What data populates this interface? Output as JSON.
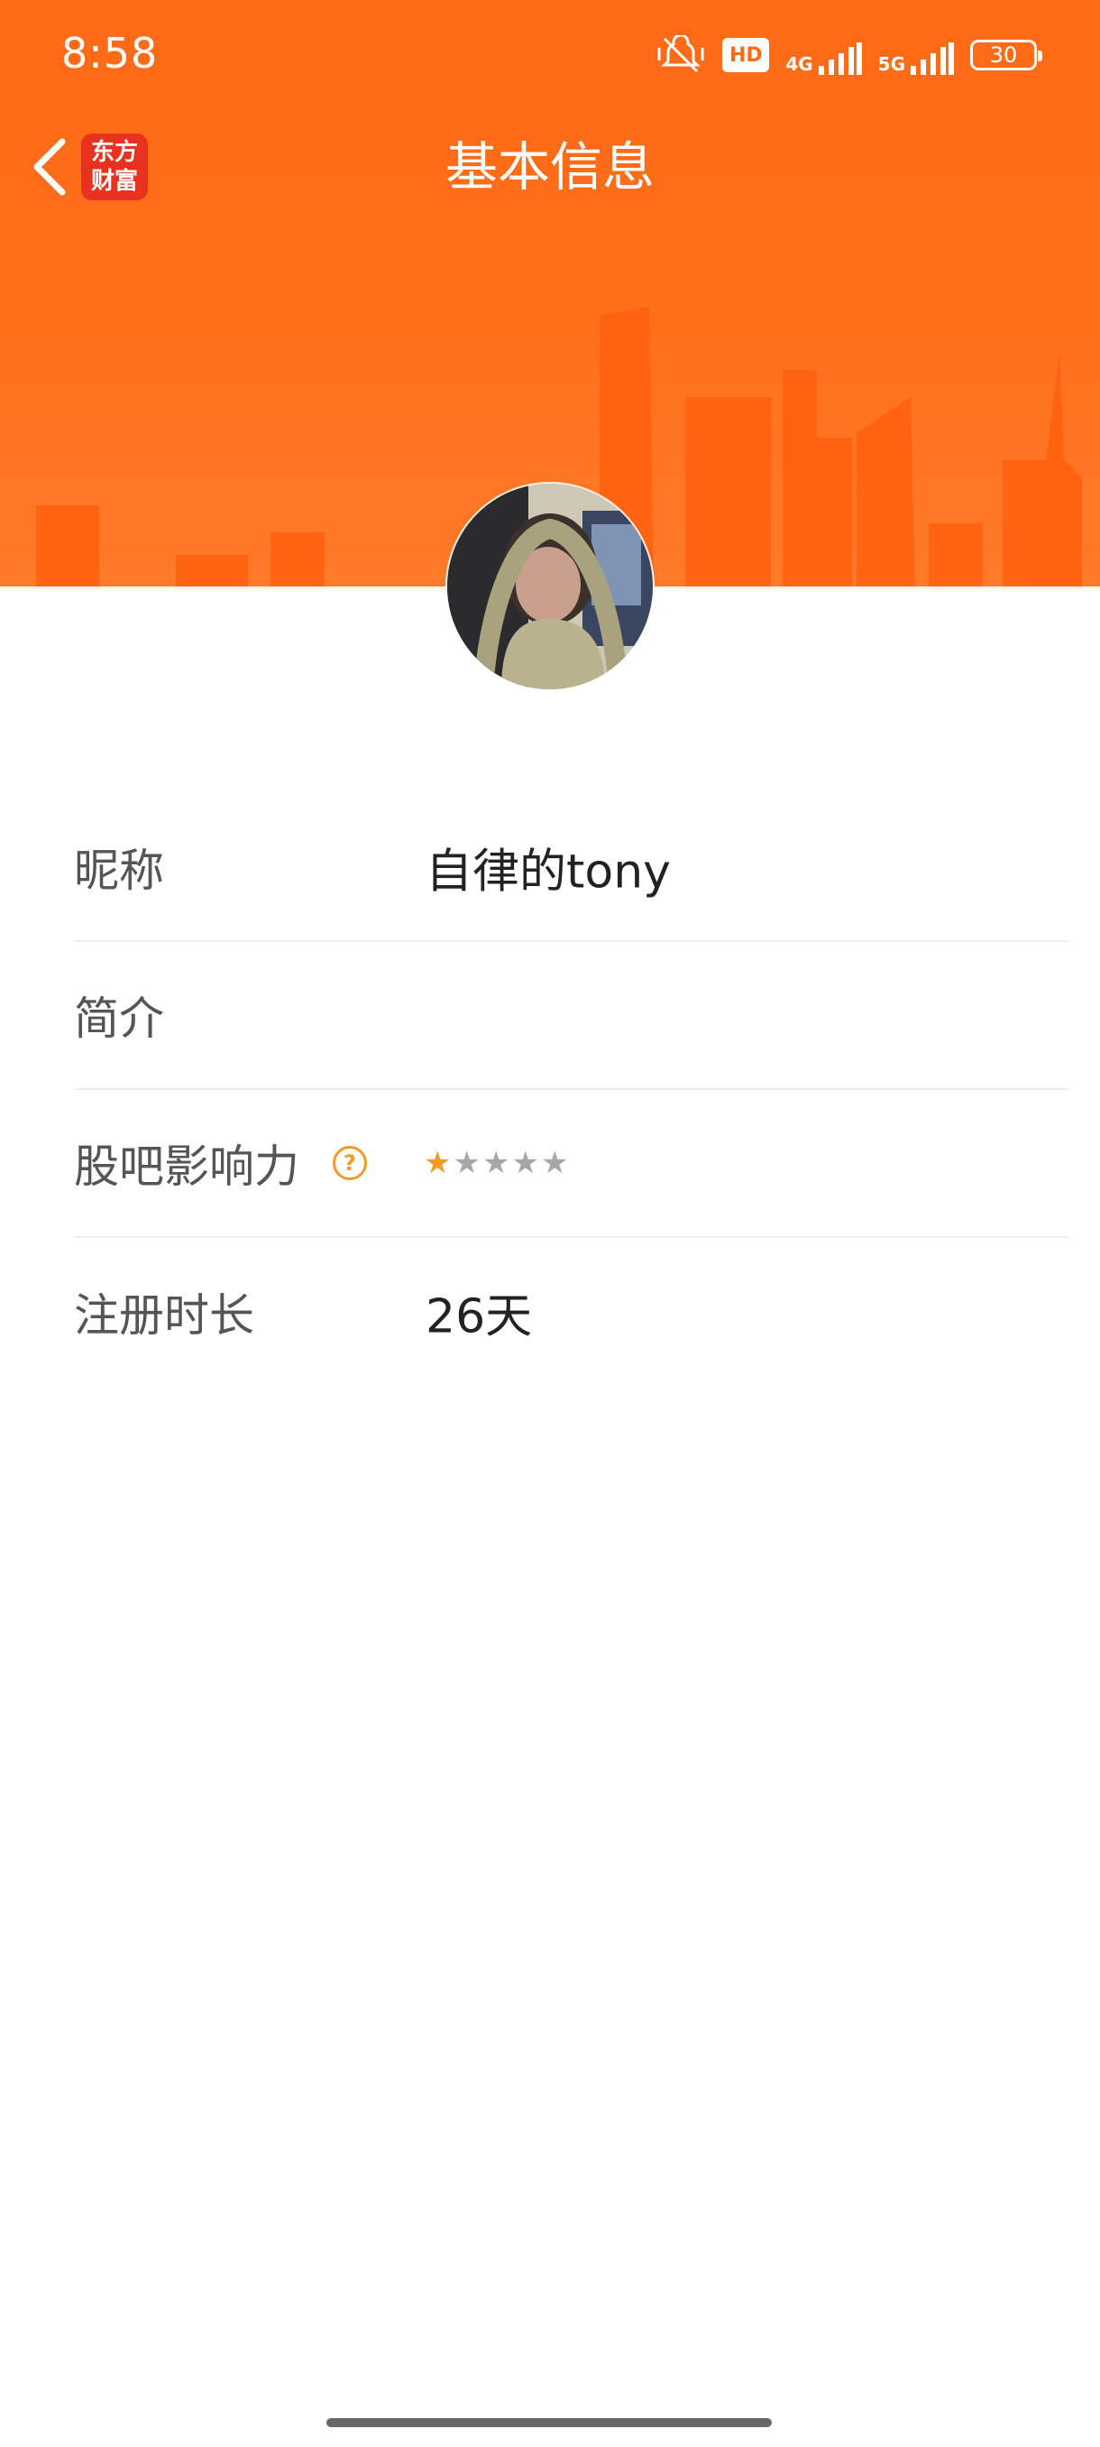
{
  "status_bar": {
    "time": "8:58",
    "hd_label": "HD",
    "network_1": "4G",
    "network_2": "5G",
    "battery": "30",
    "icons": [
      "mute-vibrate-icon",
      "hd-icon",
      "signal-4g-icon",
      "signal-5g-icon",
      "battery-icon"
    ]
  },
  "nav": {
    "title": "基本信息",
    "logo_line1": "东方",
    "logo_line2": "财富",
    "back_icon": "chevron-left-icon"
  },
  "profile": {
    "avatar_alt": "avatar-photo"
  },
  "info": {
    "nickname_label": "昵称",
    "nickname_value": "自律的tony",
    "intro_label": "简介",
    "intro_value": "",
    "influence_label": "股吧影响力",
    "influence_help": "?",
    "influence_stars": 1,
    "influence_stars_max": 5,
    "registration_label": "注册时长",
    "registration_value": "26天"
  },
  "colors": {
    "header_orange": "#ff6a16",
    "accent_star": "#f39a2a",
    "logo_red": "#e8321f"
  }
}
